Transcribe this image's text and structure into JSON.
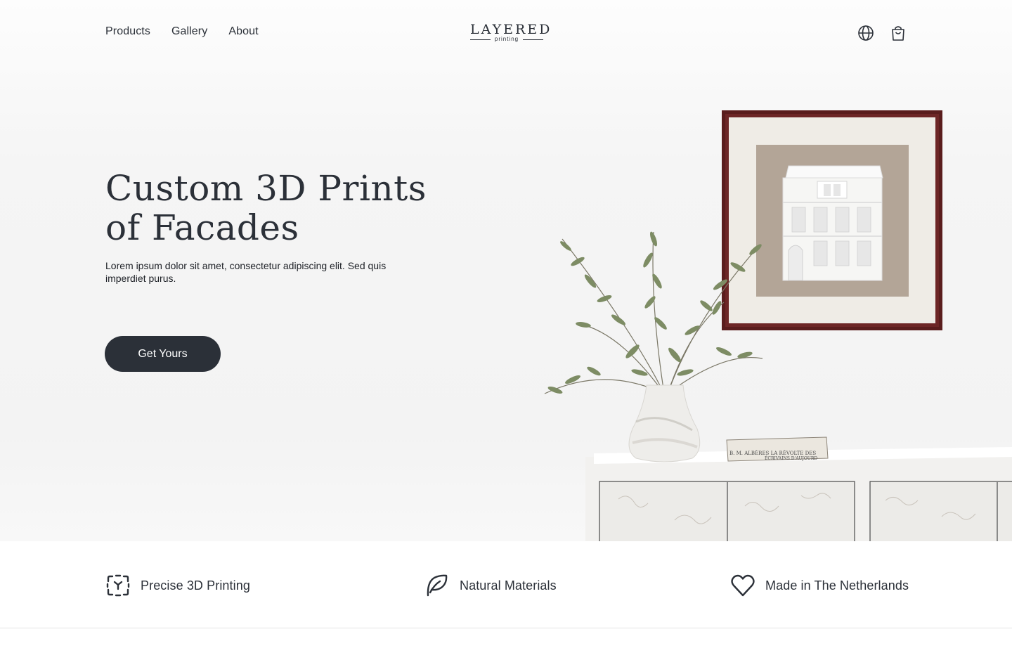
{
  "nav": {
    "links": [
      "Products",
      "Gallery",
      "About"
    ],
    "logo_word": "LAYERED",
    "logo_sub": "printing",
    "icons": [
      "globe-icon",
      "shopping-bag-icon"
    ]
  },
  "hero": {
    "title": "Custom 3D Prints\nof Facades",
    "text": "Lorem ipsum dolor sit amet, consectetur adipiscing elit. Sed quis imperdiet purus.",
    "cta_label": "Get Yours"
  },
  "scene": {
    "book_line1": "B. M. ALBÈRES   LA RÉVOLTE   DES",
    "book_line2": "ÉCRIVAINS D'AUJOURD"
  },
  "features": [
    {
      "label": "Precise 3D Printing",
      "icon": "scan-cube-icon"
    },
    {
      "label": "Natural Materials",
      "icon": "leaf-icon"
    },
    {
      "label": "Made in The Netherlands",
      "icon": "heart-icon"
    }
  ],
  "colors": {
    "primary": "#2b3038",
    "frame": "#5a1d1d",
    "mat": "#b3a597",
    "background": "#f4f4f4",
    "leaf": "#7d8c64"
  }
}
